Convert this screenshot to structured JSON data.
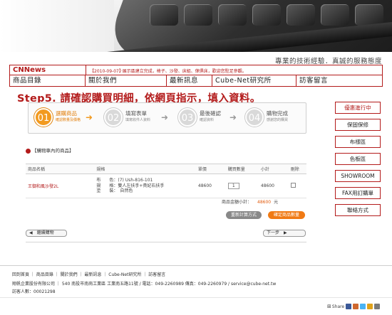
{
  "slogan": "專業的技術經驗．真誠的服務態度",
  "header": {
    "brand": "CNNews",
    "news": "【2010-09-07】‧展示區建立完成，椅子、沙發、床組、傢俱床，歡迎您駐足參觀。",
    "nav": [
      "商品目錄",
      "關於我們",
      "最新訊息",
      "Cube-Net研究所",
      "訪客留言"
    ]
  },
  "step_title": "Step5. 請確認購買明細，依網頁指示，填入資料。",
  "steps": [
    {
      "num": "01",
      "label": "選購商品",
      "sub": "確認數量及價格"
    },
    {
      "num": "02",
      "label": "填寫表單",
      "sub": "填寫收件人資料"
    },
    {
      "num": "03",
      "label": "最後確認",
      "sub": "確認資料"
    },
    {
      "num": "04",
      "label": "購物完成",
      "sub": "感謝您的購買"
    }
  ],
  "side_buttons": [
    "優惠進行中",
    "保固保修",
    "布樣區",
    "色板區",
    "SHOWROOM",
    "FAX用訂購單",
    "聯絡方式"
  ],
  "cart": {
    "title": "【購物車內的商品】",
    "headers": [
      "商品名稱",
      "規格",
      "單價",
      "購買數量",
      "小計",
      "刪除"
    ],
    "rows": [
      {
        "name": "王御和風沙發2L",
        "spec": [
          "布　　色：(7) Ush-816-101",
          "規　　格：雙人左扶手+貴妃右扶手",
          "塗　　裝：　自然色"
        ],
        "price": "48600",
        "qty": "1",
        "subtotal": "48600"
      }
    ],
    "total_label": "商品金額小計：",
    "total_amount": "48600",
    "total_unit": "元",
    "recalc_label": "重新計算方式",
    "confirm_label": "確定商品數量"
  },
  "continue_label": "◀　繼續購物",
  "next_label": "下一步　▶",
  "footer": {
    "links": "回到首頁 ｜ 商品目錄 ｜ 關於我們 ｜ 最新訊息 ｜ Cube-Net研究所 ｜ 訪客留言",
    "company": "翔帆企業股份有限公司 ｜ 540 南投市南崗工業區 工業南五路11號 / 電話：049-2260989 傳真：049-2260979 / service@cube-net.tw",
    "visitors": "訪客人數：00021298"
  },
  "share_label": "Share"
}
